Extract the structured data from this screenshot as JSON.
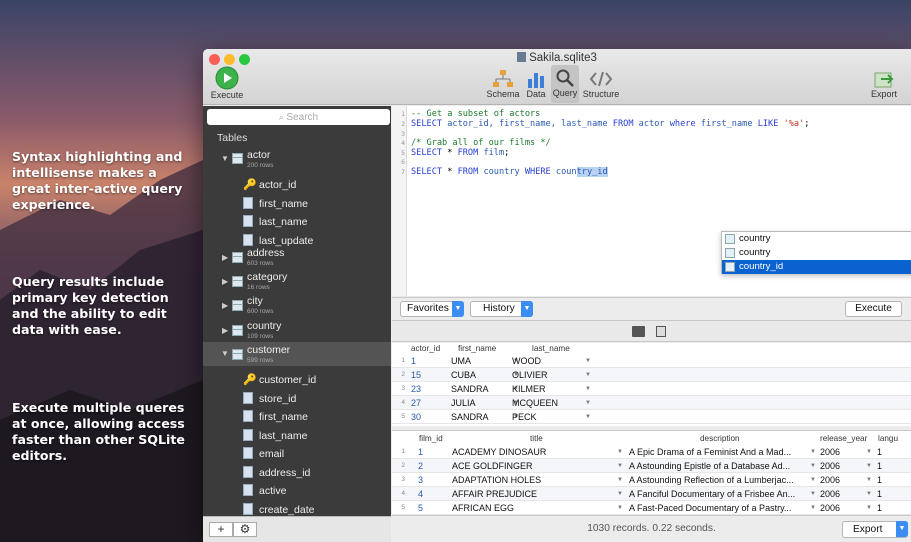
{
  "promo": [
    "Syntax highlighting and intellisense makes a great inter-active query experience.",
    "Query results include primary key detection and the ability to edit data with ease.",
    "Execute multiple queres at once, allowing access faster than other SQLite editors."
  ],
  "window": {
    "title": "Sakila.sqlite3"
  },
  "toolbar": {
    "execute": "Execute",
    "schema": "Schema",
    "data": "Data",
    "query": "Query",
    "structure": "Structure",
    "export": "Export"
  },
  "sidebar": {
    "search_placeholder": "Search",
    "tables_label": "Tables",
    "actor": {
      "name": "actor",
      "rows": "200 rows"
    },
    "actor_cols": [
      "actor_id",
      "first_name",
      "last_name",
      "last_update"
    ],
    "tables": [
      {
        "name": "address",
        "rows": "603 rows"
      },
      {
        "name": "category",
        "rows": "16 rows"
      },
      {
        "name": "city",
        "rows": "600 rows"
      },
      {
        "name": "country",
        "rows": "109 rows"
      }
    ],
    "customer": {
      "name": "customer",
      "rows": "599 rows"
    },
    "customer_cols": [
      "customer_id",
      "store_id",
      "first_name",
      "last_name",
      "email",
      "address_id",
      "active",
      "create_date"
    ],
    "add_label": "+"
  },
  "editor": {
    "line_numbers": [
      "1",
      "2",
      "3",
      "4",
      "5",
      "6",
      "7"
    ],
    "l1": "-- Get a subset of actors",
    "l2_select": "SELECT",
    "l2_cols": " actor_id, first_name, last_name ",
    "l2_from": "FROM",
    "l2_tbl": " actor ",
    "l2_where": "where",
    "l2_col": " first_name ",
    "l2_like": "LIKE",
    "l2_str": " '%a'",
    "l2_end": ";",
    "l4": "/* Grab all of our films */",
    "l5_select": "SELECT",
    "l5_mid": " * ",
    "l5_from": "FROM",
    "l5_tbl": " film",
    "l5_end": ";",
    "l7_select": "SELECT",
    "l7_mid": " * ",
    "l7_from": "FROM",
    "l7_tbl": " country ",
    "l7_where": "WHERE",
    "l7_pre": " coun",
    "l7_hl": "try_id",
    "autocomplete": [
      "country",
      "country",
      "country_id"
    ]
  },
  "querybar": {
    "favorites": "Favorites",
    "history": "History",
    "execute": "Execute"
  },
  "result1": {
    "headers": [
      "actor_id",
      "first_name",
      "last_name"
    ],
    "rows": [
      [
        "1",
        "UMA",
        "WOOD"
      ],
      [
        "15",
        "CUBA",
        "OLIVIER"
      ],
      [
        "23",
        "SANDRA",
        "KILMER"
      ],
      [
        "27",
        "JULIA",
        "MCQUEEN"
      ],
      [
        "30",
        "SANDRA",
        "PECK"
      ]
    ],
    "row_numbers": [
      "1",
      "2",
      "3",
      "4",
      "5"
    ]
  },
  "result2": {
    "headers": [
      "film_id",
      "title",
      "description",
      "release_year",
      "langu"
    ],
    "rows": [
      [
        "1",
        "ACADEMY DINOSAUR",
        "A Epic Drama of a Feminist And a Mad...",
        "2006",
        "1"
      ],
      [
        "2",
        "ACE GOLDFINGER",
        "A Astounding Epistle of a Database Ad...",
        "2006",
        "1"
      ],
      [
        "3",
        "ADAPTATION HOLES",
        "A Astounding Reflection of a Lumberjac...",
        "2006",
        "1"
      ],
      [
        "4",
        "AFFAIR PREJUDICE",
        "A Fanciful Documentary of a Frisbee An...",
        "2006",
        "1"
      ],
      [
        "5",
        "AFRICAN EGG",
        "A Fast-Paced Documentary of a Pastry...",
        "2006",
        "1"
      ]
    ],
    "row_numbers": [
      "1",
      "2",
      "3",
      "4",
      "5"
    ]
  },
  "status": {
    "text": "1030 records. 0.22 seconds.",
    "export": "Export"
  }
}
